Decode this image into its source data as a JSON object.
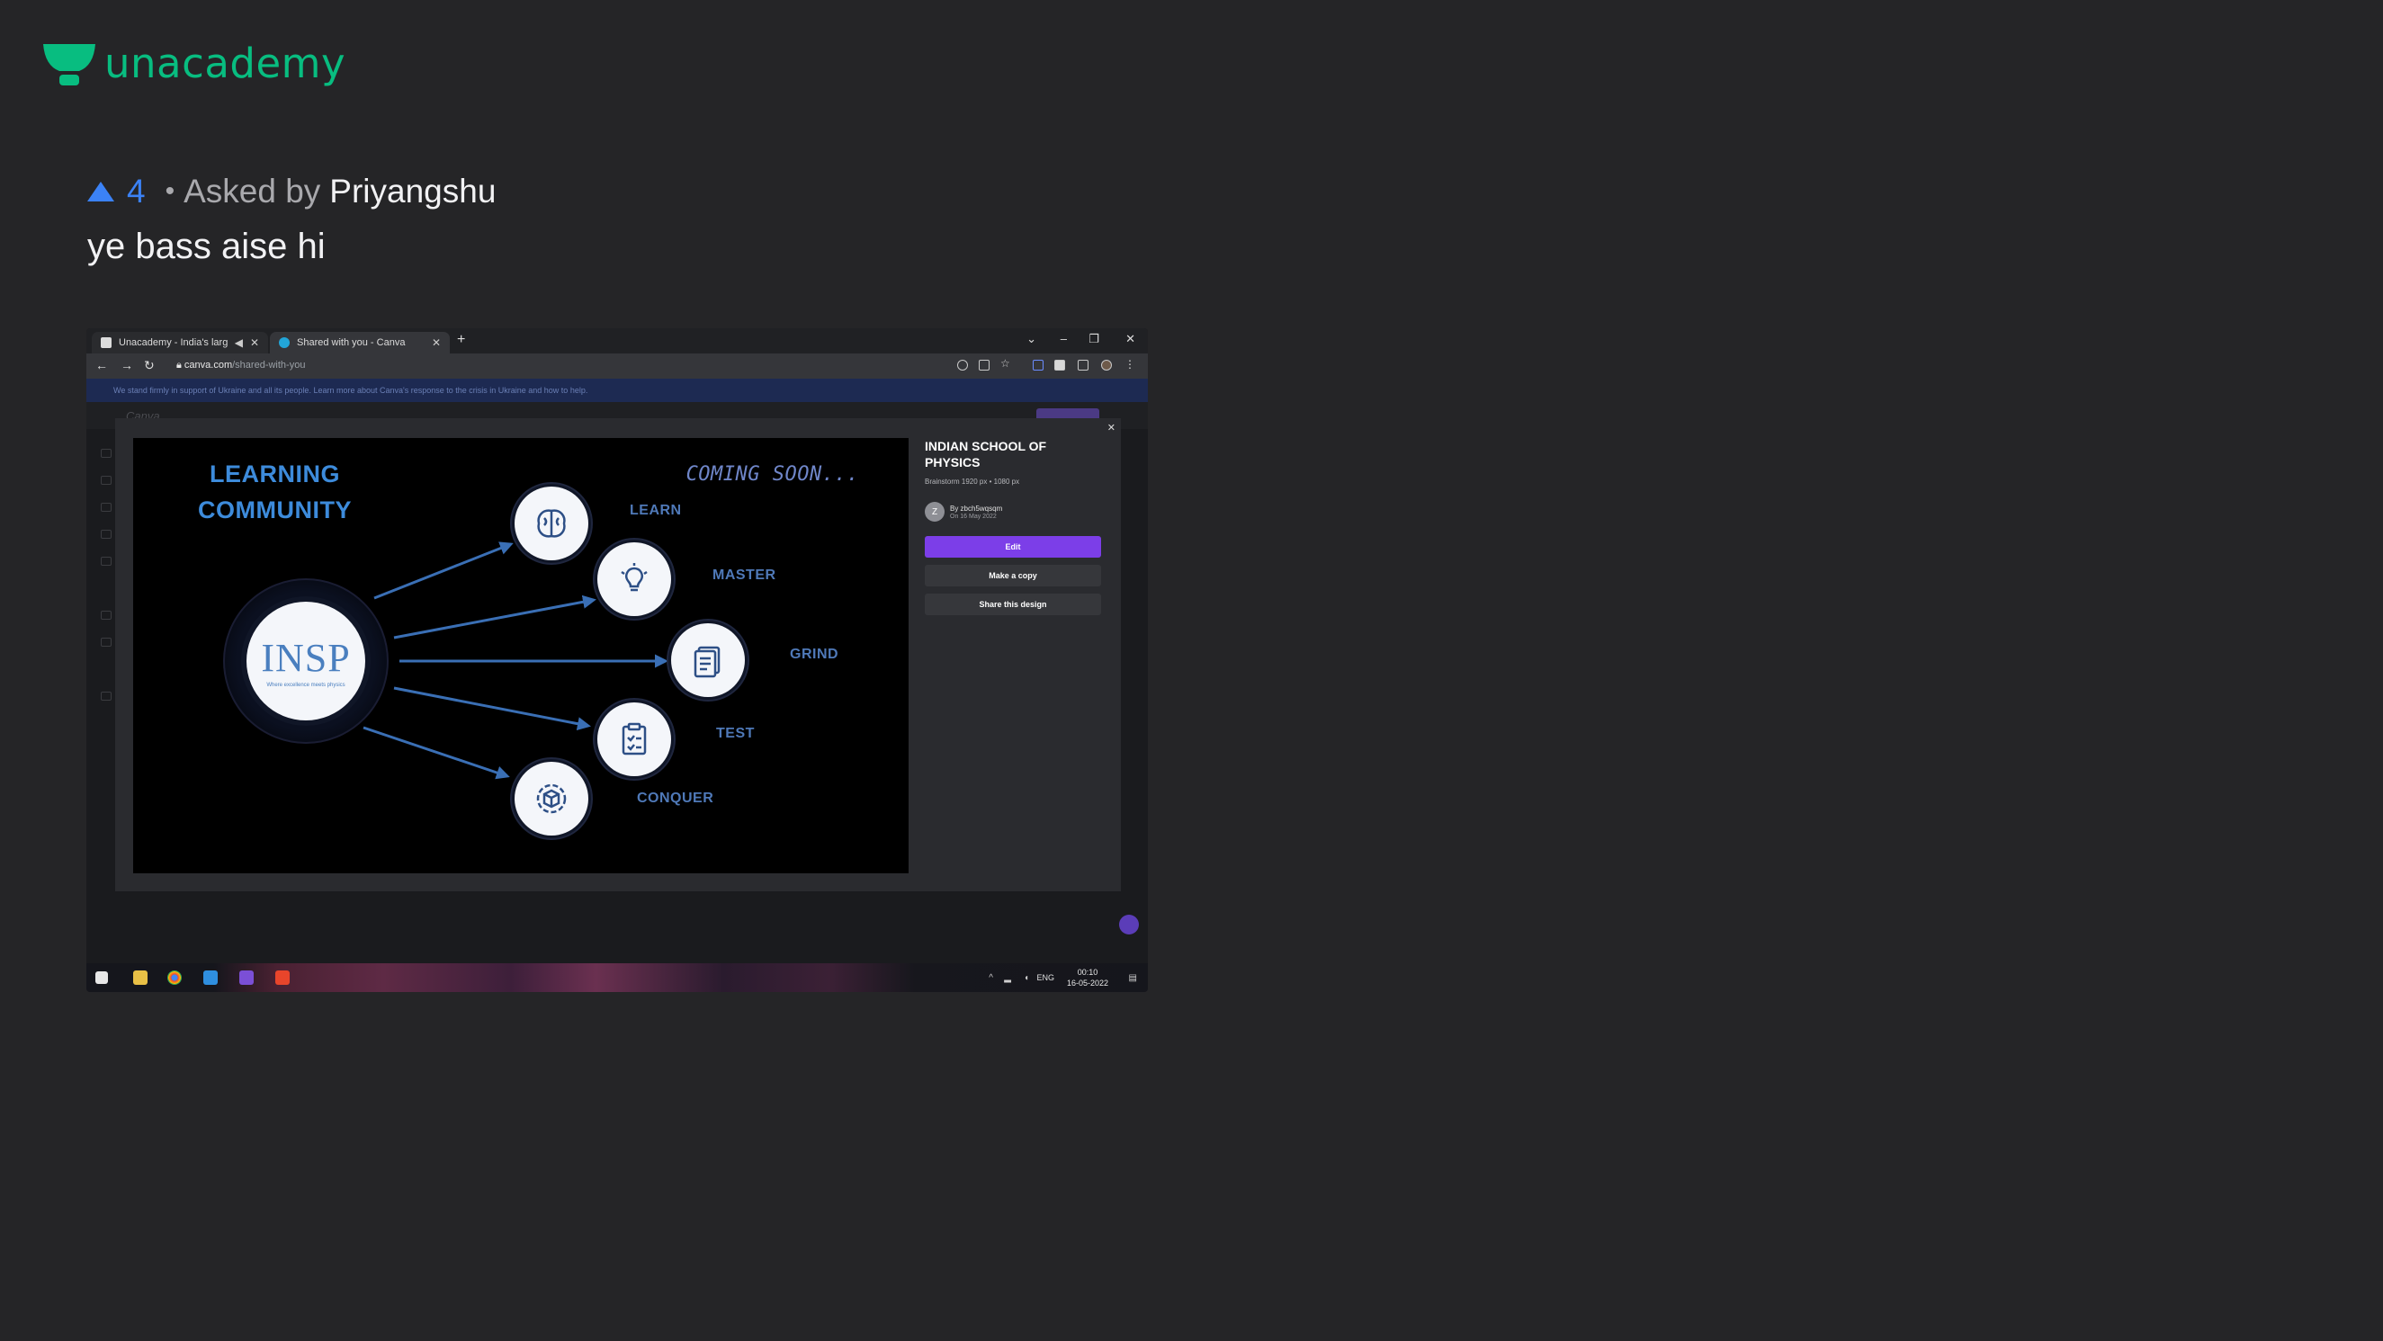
{
  "brand": {
    "name": "unacademy",
    "color": "#08bd80"
  },
  "question": {
    "votes": "4",
    "separator": "•",
    "asked_by_label": "Asked by",
    "author": "Priyangshu",
    "text": "ye bass aise hi"
  },
  "attachment": {
    "browser": {
      "tabs": [
        {
          "label": "Unacademy - India's largest",
          "icon": "speaker-icon"
        },
        {
          "label": "Shared with you - Canva"
        }
      ],
      "new_tab": "+",
      "url_host": "canva.com",
      "url_path": "/shared-with-you"
    },
    "banner_text": "We stand firmly in support of Ukraine and all its people. Learn more about Canva's response to the crisis in Ukraine and how to help.",
    "design": {
      "title_line1": "LEARNING",
      "title_line2": "COMMUNITY",
      "coming_soon": "COMING SOON...",
      "hub_text": "INSP",
      "hub_tagline": "Where excellence meets physics",
      "nodes": [
        {
          "label": "LEARN",
          "icon": "brain-icon"
        },
        {
          "label": "MASTER",
          "icon": "lightbulb-icon"
        },
        {
          "label": "GRIND",
          "icon": "document-icon"
        },
        {
          "label": "TEST",
          "icon": "clipboard-icon"
        },
        {
          "label": "CONQUER",
          "icon": "cube-icon"
        }
      ]
    },
    "panel": {
      "title": "INDIAN SCHOOL OF PHYSICS",
      "subtitle": "Brainstorm 1920 px • 1080 px",
      "owner_initial": "Z",
      "owner": "By zbch5wqsqm",
      "date": "On 16 May 2022",
      "edit_label": "Edit",
      "copy_label": "Make a copy",
      "share_label": "Share this design",
      "accent": "#7c3ee8"
    },
    "taskbar": {
      "lang": "ENG",
      "time": "00:10",
      "date": "16-05-2022"
    }
  }
}
